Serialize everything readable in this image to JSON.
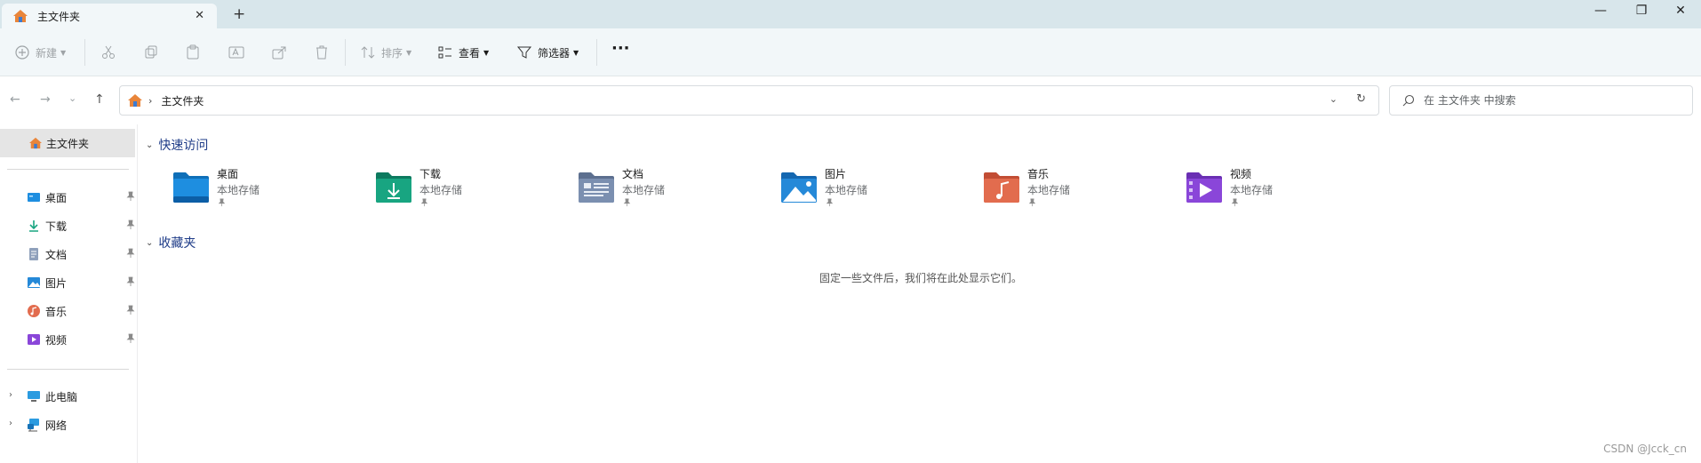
{
  "window": {
    "tab_title": "主文件夹",
    "tab_close": "✕",
    "new_tab": "+",
    "minimize": "—",
    "restore": "❐",
    "close": "✕"
  },
  "toolbar": {
    "new_label": "新建",
    "sort_label": "排序",
    "view_label": "查看",
    "filter_label": "筛选器",
    "more_label": "···"
  },
  "address": {
    "path": "主文件夹",
    "dropdown": "⌄",
    "refresh": "↻",
    "back": "←",
    "forward": "→",
    "recent": "⌄",
    "up": "↑"
  },
  "search": {
    "placeholder": "在 主文件夹 中搜索"
  },
  "sidebar": {
    "home_label": "主文件夹",
    "pinned": [
      {
        "label": "桌面",
        "icon": "desktop-icon"
      },
      {
        "label": "下载",
        "icon": "download-icon"
      },
      {
        "label": "文档",
        "icon": "document-icon"
      },
      {
        "label": "图片",
        "icon": "picture-icon"
      },
      {
        "label": "音乐",
        "icon": "music-icon"
      },
      {
        "label": "视频",
        "icon": "video-icon"
      }
    ],
    "this_pc": "此电脑",
    "network": "网络",
    "expand": "›"
  },
  "main": {
    "quick_access_title": "快速访问",
    "favorites_title": "收藏夹",
    "collapse": "⌄",
    "quick_access": [
      {
        "name": "桌面",
        "sub": "本地存储",
        "color": "#1e8ee0"
      },
      {
        "name": "下载",
        "sub": "本地存储",
        "color": "#18a581"
      },
      {
        "name": "文档",
        "sub": "本地存储",
        "color": "#7b8fb0"
      },
      {
        "name": "图片",
        "sub": "本地存储",
        "color": "#2589d8"
      },
      {
        "name": "音乐",
        "sub": "本地存储",
        "color": "#e26c4e"
      },
      {
        "name": "视频",
        "sub": "本地存储",
        "color": "#8a46d9"
      }
    ],
    "favorites_empty": "固定一些文件后，我们将在此处显示它们。"
  },
  "watermark": "CSDN @Jcck_cn"
}
